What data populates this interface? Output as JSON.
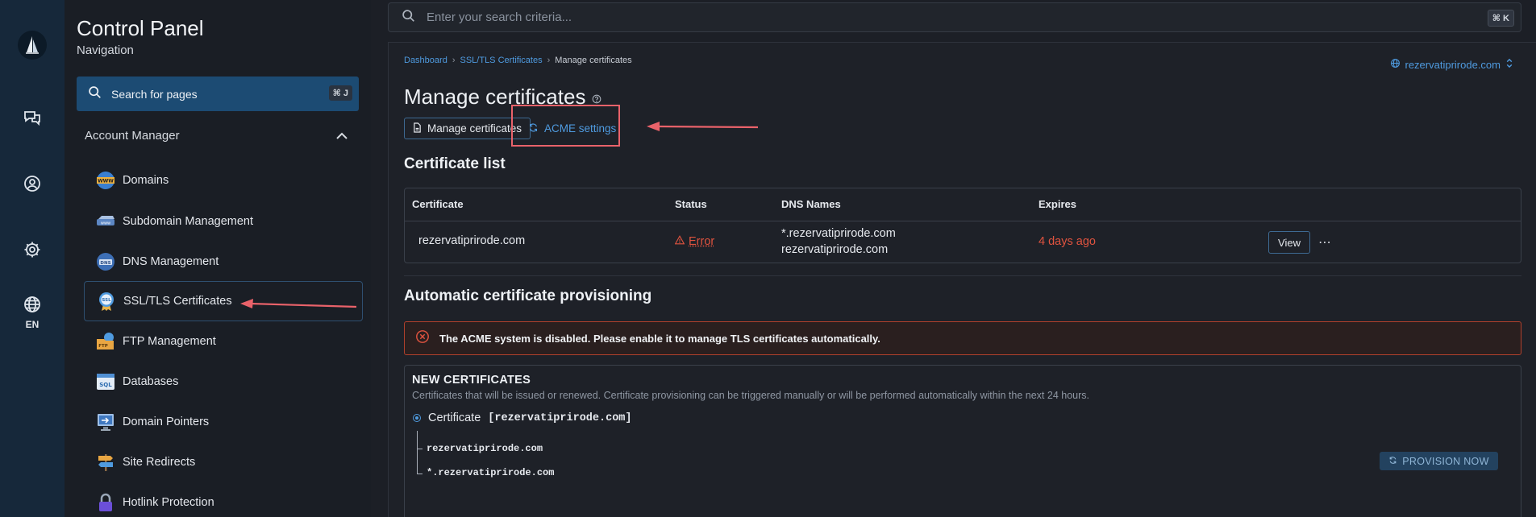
{
  "rail": {
    "lang_label": "EN"
  },
  "sidebar": {
    "title": "Control Panel",
    "subtitle": "Navigation",
    "search_label": "Search for pages",
    "search_shortcut": "⌘ J",
    "section_label": "Account Manager",
    "items": [
      {
        "label": "Domains",
        "icon": "www-globe-icon"
      },
      {
        "label": "Subdomain Management",
        "icon": "subdomain-icon"
      },
      {
        "label": "DNS Management",
        "icon": "dns-icon"
      },
      {
        "label": "SSL/TLS Certificates",
        "icon": "ssl-badge-icon"
      },
      {
        "label": "FTP Management",
        "icon": "ftp-folder-icon"
      },
      {
        "label": "Databases",
        "icon": "sql-database-icon"
      },
      {
        "label": "Domain Pointers",
        "icon": "monitor-icon"
      },
      {
        "label": "Site Redirects",
        "icon": "signpost-icon"
      },
      {
        "label": "Hotlink Protection",
        "icon": "padlock-icon"
      }
    ]
  },
  "topbar": {
    "search_placeholder": "Enter your search criteria...",
    "search_shortcut": "⌘ K"
  },
  "main": {
    "breadcrumb": [
      "Dashboard",
      "SSL/TLS Certificates",
      "Manage certificates"
    ],
    "domain_selector": "rezervatiprirode.com",
    "title": "Manage certificates",
    "tabs": [
      "Manage certificates",
      "ACME settings"
    ],
    "certificate_list_title": "Certificate list",
    "table": {
      "headers": [
        "Certificate",
        "Status",
        "DNS Names",
        "Expires"
      ],
      "rows": [
        {
          "certificate": "rezervatiprirode.com",
          "status": "Error",
          "dns_names": [
            "*.rezervatiprirode.com",
            "rezervatiprirode.com"
          ],
          "expires": "4 days ago",
          "action": "View"
        }
      ]
    },
    "provisioning_title": "Automatic certificate provisioning",
    "alert": "The ACME system is disabled. Please enable it to manage TLS certificates automatically.",
    "new_certificates": {
      "title": "NEW CERTIFICATES",
      "description": "Certificates that will be issued or renewed. Certificate provisioning can be triggered manually or will be performed automatically within the next 24 hours.",
      "certificate_label": "Certificate",
      "certificate_name": "[rezervatiprirode.com]",
      "names": [
        "rezervatiprirode.com",
        "*.rezervatiprirode.com"
      ],
      "provision_button": "PROVISION NOW"
    }
  },
  "colors": {
    "accent": "#4f9be0",
    "error": "#e0533f",
    "annotation": "#e9626a"
  }
}
